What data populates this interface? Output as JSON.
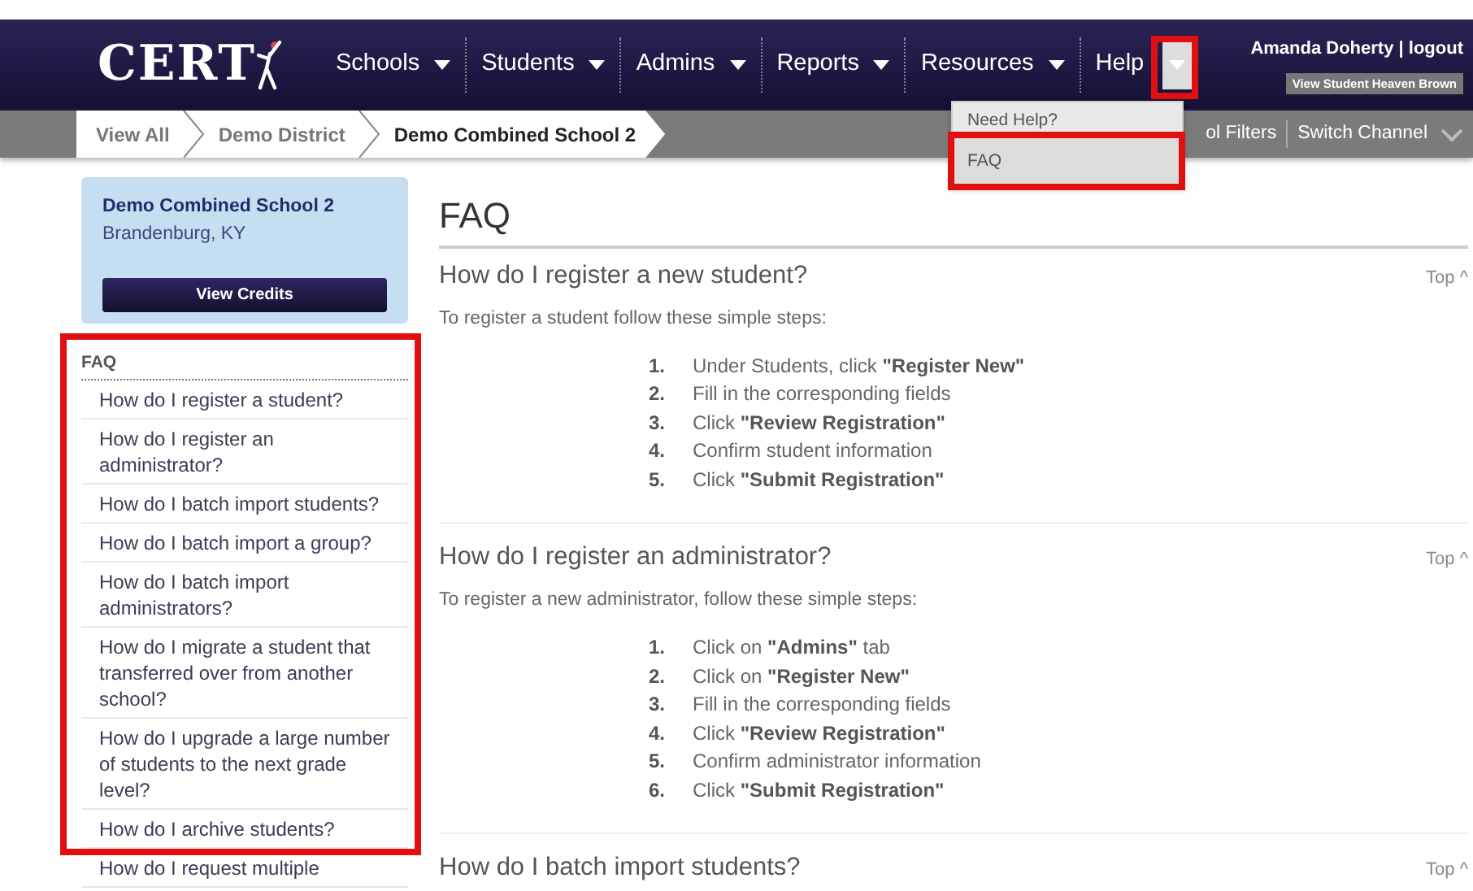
{
  "header": {
    "logo": "CERT",
    "nav": [
      {
        "label": "Schools",
        "has_menu": true
      },
      {
        "label": "Students",
        "has_menu": true
      },
      {
        "label": "Admins",
        "has_menu": true
      },
      {
        "label": "Reports",
        "has_menu": true
      },
      {
        "label": "Resources",
        "has_menu": true
      },
      {
        "label": "Help",
        "has_menu": false
      }
    ],
    "help_toggle": {
      "expanded": true,
      "highlighted": true
    },
    "user": "Amanda Doherty | logout",
    "view_as_button": "View Student Heaven Brown"
  },
  "breadcrumbs": [
    {
      "label": "View All",
      "selected": false
    },
    {
      "label": "Demo District",
      "selected": false
    },
    {
      "label": "Demo Combined School 2",
      "selected": true
    }
  ],
  "filters": [
    "ol Filters",
    "Switch Channel"
  ],
  "help_menu": {
    "items": [
      {
        "label": "Need Help?",
        "selected": false,
        "highlighted": false
      },
      {
        "label": "FAQ",
        "selected": true,
        "highlighted": true
      }
    ]
  },
  "school_card": {
    "name": "Demo Combined School 2",
    "location": "Brandenburg, KY",
    "button": "View Credits"
  },
  "faq_nav": {
    "title": "FAQ",
    "highlighted": true,
    "items": [
      "How do I register a student?",
      "How do I register an administrator?",
      "How do I batch import students?",
      "How do I batch import a group?",
      "How do I batch import administrators?",
      "How do I migrate a student that transferred over from another school?",
      "How do I upgrade a large number of students to the next grade level?",
      "How do I archive students?",
      "How do I request multiple"
    ]
  },
  "content": {
    "title": "FAQ",
    "sections": [
      {
        "question": "How do I register a new student?",
        "top_link": "Top ^",
        "intro": "To register a student follow these simple steps:",
        "steps": [
          {
            "number": "1.",
            "text": "Under Students, click **\"Register New\"**"
          },
          {
            "number": "2.",
            "text": "Fill in the corresponding fields"
          },
          {
            "number": "3.",
            "text": "Click **\"Review Registration\"**"
          },
          {
            "number": "4.",
            "text": "Confirm student information"
          },
          {
            "number": "5.",
            "text": "Click **\"Submit Registration\"**"
          }
        ]
      },
      {
        "question": "How do I register an administrator?",
        "top_link": "Top ^",
        "intro": "To register a new administrator, follow these simple steps:",
        "steps": [
          {
            "number": "1.",
            "text": "Click on **\"Admins\"** tab"
          },
          {
            "number": "2.",
            "text": "Click on **\"Register New\"**"
          },
          {
            "number": "3.",
            "text": "Fill in the corresponding fields"
          },
          {
            "number": "4.",
            "text": "Click **\"Review Registration\"**"
          },
          {
            "number": "5.",
            "text": "Confirm administrator information"
          },
          {
            "number": "6.",
            "text": "Click **\"Submit Registration\"**"
          }
        ]
      },
      {
        "question": "How do I batch import students?",
        "top_link": "Top ^"
      }
    ]
  }
}
